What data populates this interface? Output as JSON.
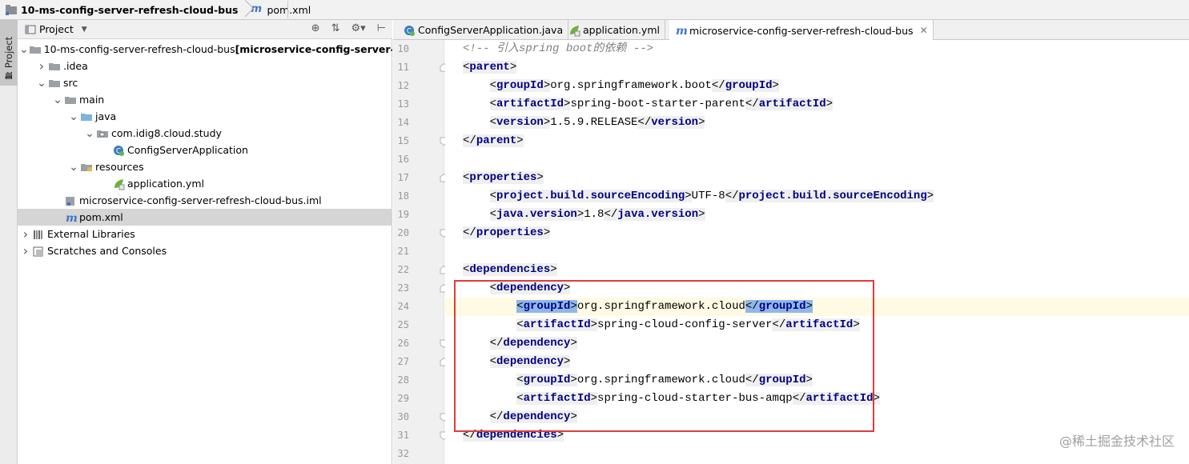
{
  "navbar": {
    "project_name": "10-ms-config-server-refresh-cloud-bus",
    "file_name": "pom.xml"
  },
  "stripe": {
    "label": "1: Project"
  },
  "project_panel": {
    "title": "Project",
    "tree": [
      {
        "label": "10-ms-config-server-refresh-cloud-bus",
        "suffix": " [microservice-config-server-refre",
        "indent": 0,
        "toggle": "open",
        "icon": "folder"
      },
      {
        "label": ".idea",
        "indent": 1,
        "toggle": "closed",
        "icon": "folder"
      },
      {
        "label": "src",
        "indent": 1,
        "toggle": "open",
        "icon": "folder"
      },
      {
        "label": "main",
        "indent": 2,
        "toggle": "open",
        "icon": "folder"
      },
      {
        "label": "java",
        "indent": 3,
        "toggle": "open",
        "icon": "source-folder"
      },
      {
        "label": "com.idig8.cloud.study",
        "indent": 4,
        "toggle": "open",
        "icon": "package"
      },
      {
        "label": "ConfigServerApplication",
        "indent": 5,
        "toggle": "none",
        "icon": "class"
      },
      {
        "label": "resources",
        "indent": 3,
        "toggle": "open",
        "icon": "resources-folder"
      },
      {
        "label": "application.yml",
        "indent": 5,
        "toggle": "none",
        "icon": "spring-yml"
      },
      {
        "label": "microservice-config-server-refresh-cloud-bus.iml",
        "indent": 2,
        "toggle": "none",
        "icon": "iml"
      },
      {
        "label": "pom.xml",
        "indent": 2,
        "toggle": "none",
        "icon": "maven",
        "selected": true
      },
      {
        "label": "External Libraries",
        "indent": 0,
        "toggle": "closed",
        "icon": "libraries"
      },
      {
        "label": "Scratches and Consoles",
        "indent": 0,
        "toggle": "closed",
        "icon": "scratches"
      }
    ]
  },
  "tabs": [
    {
      "label": "ConfigServerApplication.java",
      "icon": "class",
      "active": false
    },
    {
      "label": "application.yml",
      "icon": "spring-yml",
      "active": false
    },
    {
      "label": "microservice-config-server-refresh-cloud-bus",
      "icon": "maven",
      "active": true,
      "closable": true
    }
  ],
  "editor": {
    "current_line": 24,
    "lines": [
      {
        "n": 10,
        "text": "<!-- 引入spring boot的依赖 -->",
        "kind": "comment"
      },
      {
        "n": 11,
        "text": "<parent>"
      },
      {
        "n": 12,
        "text": "    <groupId>org.springframework.boot</groupId>"
      },
      {
        "n": 13,
        "text": "    <artifactId>spring-boot-starter-parent</artifactId>"
      },
      {
        "n": 14,
        "text": "    <version>1.5.9.RELEASE</version>"
      },
      {
        "n": 15,
        "text": "</parent>"
      },
      {
        "n": 16,
        "text": ""
      },
      {
        "n": 17,
        "text": "<properties>"
      },
      {
        "n": 18,
        "text": "    <project.build.sourceEncoding>UTF-8</project.build.sourceEncoding>"
      },
      {
        "n": 19,
        "text": "    <java.version>1.8</java.version>"
      },
      {
        "n": 20,
        "text": "</properties>"
      },
      {
        "n": 21,
        "text": ""
      },
      {
        "n": 22,
        "text": "<dependencies>"
      },
      {
        "n": 23,
        "text": "    <dependency>"
      },
      {
        "n": 24,
        "text": "        <groupId>org.springframework.cloud</groupId>"
      },
      {
        "n": 25,
        "text": "        <artifactId>spring-cloud-config-server</artifactId>"
      },
      {
        "n": 26,
        "text": "    </dependency>"
      },
      {
        "n": 27,
        "text": "    <dependency>"
      },
      {
        "n": 28,
        "text": "        <groupId>org.springframework.cloud</groupId>"
      },
      {
        "n": 29,
        "text": "        <artifactId>spring-cloud-starter-bus-amqp</artifactId>"
      },
      {
        "n": 30,
        "text": "    </dependency>"
      },
      {
        "n": 31,
        "text": "</dependencies>"
      },
      {
        "n": 32,
        "text": ""
      }
    ]
  },
  "watermark": "@稀土掘金技术社区",
  "colors": {
    "tag": "#000080",
    "highlight_box": "#e03c3c",
    "current_line": "#fffae3"
  }
}
